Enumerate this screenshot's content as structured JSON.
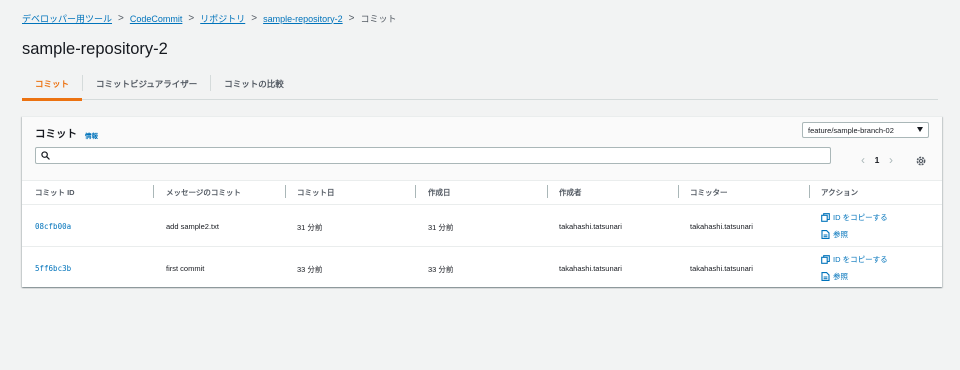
{
  "breadcrumb": {
    "items": [
      "デベロッパー用ツール",
      "CodeCommit",
      "リポジトリ",
      "sample-repository-2"
    ],
    "current": "コミット",
    "separator": ">"
  },
  "page": {
    "title": "sample-repository-2"
  },
  "tabs": [
    {
      "label": "コミット",
      "active": true
    },
    {
      "label": "コミットビジュアライザー",
      "active": false
    },
    {
      "label": "コミットの比較",
      "active": false
    }
  ],
  "panel": {
    "title": "コミット",
    "info_label": "情報",
    "branch_selected": "feature/sample-branch-02",
    "search": {
      "value": "",
      "placeholder": ""
    },
    "pagination": {
      "prev": "‹",
      "page": "1",
      "next": "›"
    }
  },
  "table": {
    "columns": [
      "コミット ID",
      "メッセージのコミット",
      "コミット日",
      "作成日",
      "作成者",
      "コミッター",
      "アクション"
    ],
    "rows": [
      {
        "id": "08cfb00a",
        "message": "add sample2.txt",
        "commit_date": "31 分前",
        "created_date": "31 分前",
        "author": "takahashi.tatsunari",
        "committer": "takahashi.tatsunari",
        "copy_label": "ID をコピーする",
        "browse_label": "参照"
      },
      {
        "id": "5ff6bc3b",
        "message": "first commit",
        "commit_date": "33 分前",
        "created_date": "33 分前",
        "author": "takahashi.tatsunari",
        "committer": "takahashi.tatsunari",
        "copy_label": "ID をコピーする",
        "browse_label": "参照"
      }
    ]
  },
  "colors": {
    "link": "#0073bb",
    "accent": "#ec7211",
    "background": "#f2f3f3"
  }
}
